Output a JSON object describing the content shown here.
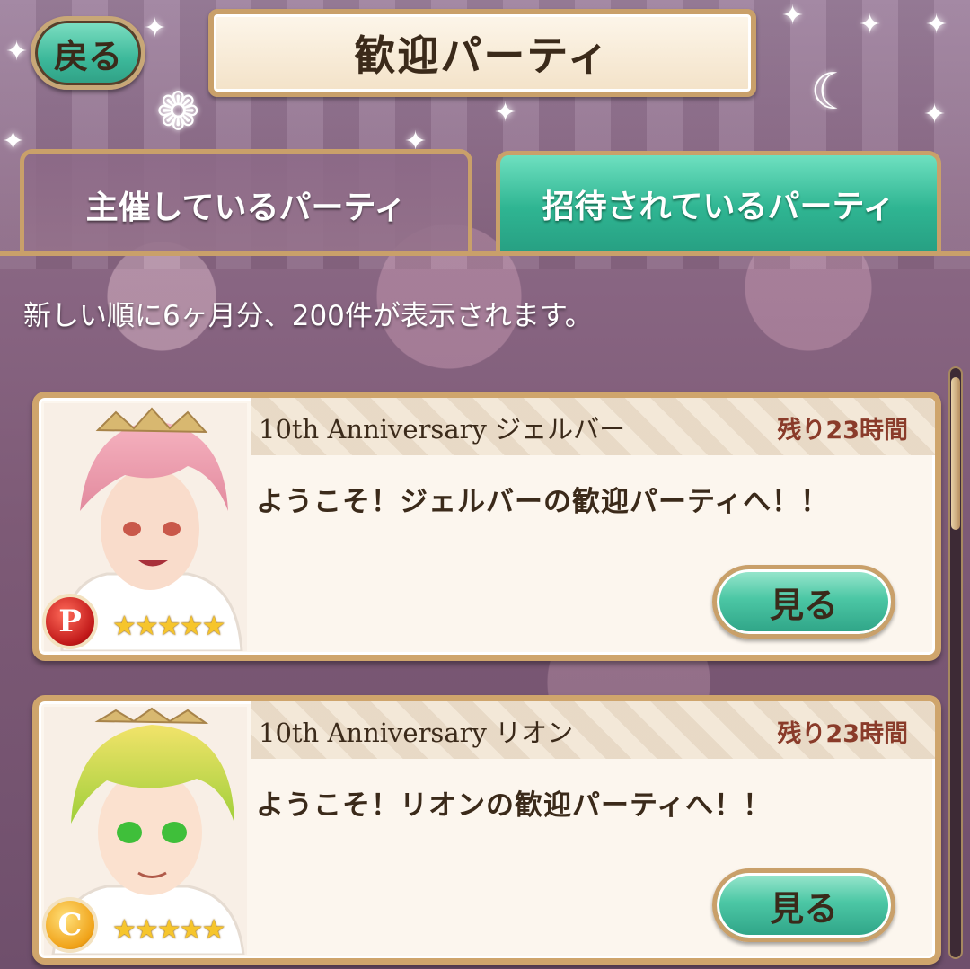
{
  "header": {
    "back_label": "戻る",
    "title": "歓迎パーティ"
  },
  "tabs": {
    "hosting": "主催しているパーティ",
    "invited": "招待されているパーティ"
  },
  "notice": "新しい順に6ヶ月分、200件が表示されます。",
  "parties": [
    {
      "name": "10th Anniversary ジェルバー",
      "remaining": "残り23時間",
      "message": "ようこそ！ジェルバーの歓迎パーティへ！！",
      "button": "見る",
      "attribute_badge": "P",
      "attribute_color": "#c01818",
      "stars": "★★★★★",
      "rarity": 5
    },
    {
      "name": "10th Anniversary リオン",
      "remaining": "残り23時間",
      "message": "ようこそ！リオンの歓迎パーティへ！！",
      "button": "見る",
      "attribute_badge": "C",
      "attribute_color": "#f0a218",
      "stars": "★★★★★",
      "rarity": 5
    }
  ],
  "icons": {
    "moon": "crescent-moon-icon",
    "flower": "flower-ornament-icon",
    "sparkle": "sparkle-icon"
  }
}
